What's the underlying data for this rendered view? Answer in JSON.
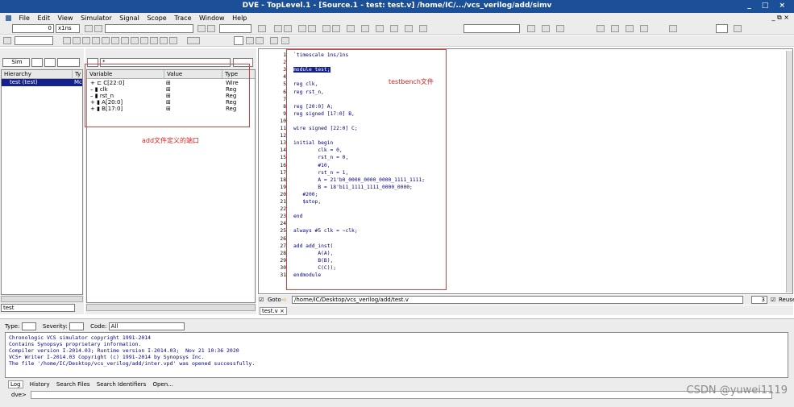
{
  "window": {
    "title": "DVE - TopLevel.1 - [Source.1 - test: test.v]  /home/IC/.../vcs_verilog/add/simv",
    "controls": "_ □ ×"
  },
  "menu": [
    "File",
    "Edit",
    "View",
    "Simulator",
    "Signal",
    "Scope",
    "Trace",
    "Window",
    "Help"
  ],
  "toolbar": {
    "time_value": "0",
    "time_unit": "x1ns"
  },
  "hier": {
    "mode_label": "Sim",
    "col_hierarchy": "Hierarchy",
    "col_type": "Ty",
    "item_name": "test (test)",
    "item_type": "Mc",
    "bottom_input": "test"
  },
  "vars": {
    "filter": "*",
    "headers": [
      "Variable",
      "Value",
      "Type"
    ],
    "rows": [
      {
        "name": "C[22:0]",
        "value": "⊞",
        "type": "Wire"
      },
      {
        "name": "clk",
        "value": "⊞",
        "type": "Reg"
      },
      {
        "name": "rst_n",
        "value": "⊞",
        "type": "Reg"
      },
      {
        "name": "A[20:0]",
        "value": "⊞",
        "type": "Reg"
      },
      {
        "name": "B[17:0]",
        "value": "⊞",
        "type": "Reg"
      }
    ],
    "annotation": "add文件定义的端口"
  },
  "source": {
    "annotation": "testbench文件",
    "lines": [
      "`timescale 1ns/1ns",
      "",
      "module test;",
      "",
      "reg clk,",
      "reg rst_n,",
      "",
      "reg [20:0] A;",
      "reg signed [17:0] B,",
      "",
      "wire signed [22:0] C;",
      "",
      "initial begin",
      "        clk = 0,",
      "        rst_n = 0,",
      "        #10,",
      "        rst_n = 1,",
      "        A = 21'b0_0000_0000_0000_1111_1111;",
      "        B = 18'b11_1111_1111_0000_0000;",
      "   #200;",
      "   $stop,",
      "",
      "end",
      "",
      "always #5 clk = ~clk;",
      "",
      "add add_inst(",
      "        A(A),",
      "        B(B),",
      "        C(C));",
      "endmodule"
    ],
    "goto_label": "Goto",
    "path": "/home/IC/Desktop/vcs_verilog/add/test.v",
    "tab": "test.v",
    "reuse_count": "3",
    "reuse_label": "Reuse"
  },
  "console": {
    "type_label": "Type:",
    "severity_label": "Severity:",
    "code_label": "Code:",
    "code_value": "All",
    "lines": [
      "Chronologic VCS simulator copyright 1991-2014",
      "Contains Synopsys proprietary information.",
      "Compiler version I-2014.03; Runtime version I-2014.03;  Nov 21 10:36 2020",
      "VCS+ Writer I-2014.03 Copyright (c) 1991-2014 by Synopsys Inc.",
      "The file '/home/IC/Desktop/vcs_verilog/add/inter.vpd' was opened successfully."
    ],
    "tabs": [
      "Log",
      "History",
      "Search Files",
      "Search Identifiers",
      "Open..."
    ],
    "prompt": "dve>"
  },
  "watermark": "CSDN @yuwei1119"
}
